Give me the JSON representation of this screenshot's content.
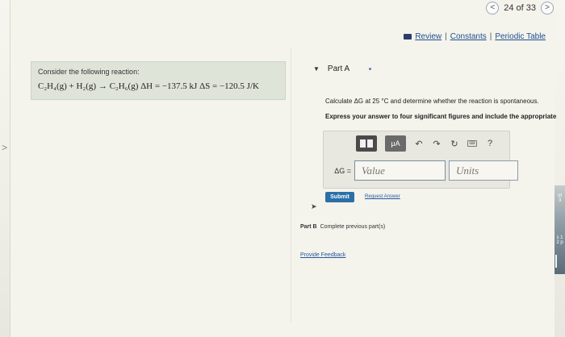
{
  "nav": {
    "prev": "<",
    "pager": "24 of 33",
    "next": ">"
  },
  "resources": {
    "review": "Review",
    "constants": "Constants",
    "periodic_table": "Periodic Table",
    "sep1": "|",
    "sep2": "|"
  },
  "problem": {
    "intro": "Consider the following reaction:",
    "equation": "C₂H₄(g) + H₂(g) → C₂H₆(g)  ΔH = −137.5 kJ  ΔS = −120.5 J/K"
  },
  "part_a": {
    "title": "Part A",
    "question": "Calculate ΔG at 25 °C and determine whether the reaction is spontaneous.",
    "instruction": "Express your answer to four significant figures and include the appropriate",
    "toolbar": {
      "units_label": "μA",
      "undo": "↶",
      "redo": "↷",
      "reset": "↻",
      "keyboard": "⌨",
      "help": "?"
    },
    "delta_g_label": "ΔG =",
    "value_placeholder": "Value",
    "units_placeholder": "Units",
    "submit": "Submit",
    "request_answer": "Request Answer"
  },
  "part_b": {
    "label": "Part B",
    "text": "Complete previous part(s)"
  },
  "feedback": "Provide Feedback",
  "sliver": {
    "line1": "ot",
    "line2": "3",
    "line3": "s 1",
    "line4": "2 p"
  },
  "left_chevron": ">"
}
